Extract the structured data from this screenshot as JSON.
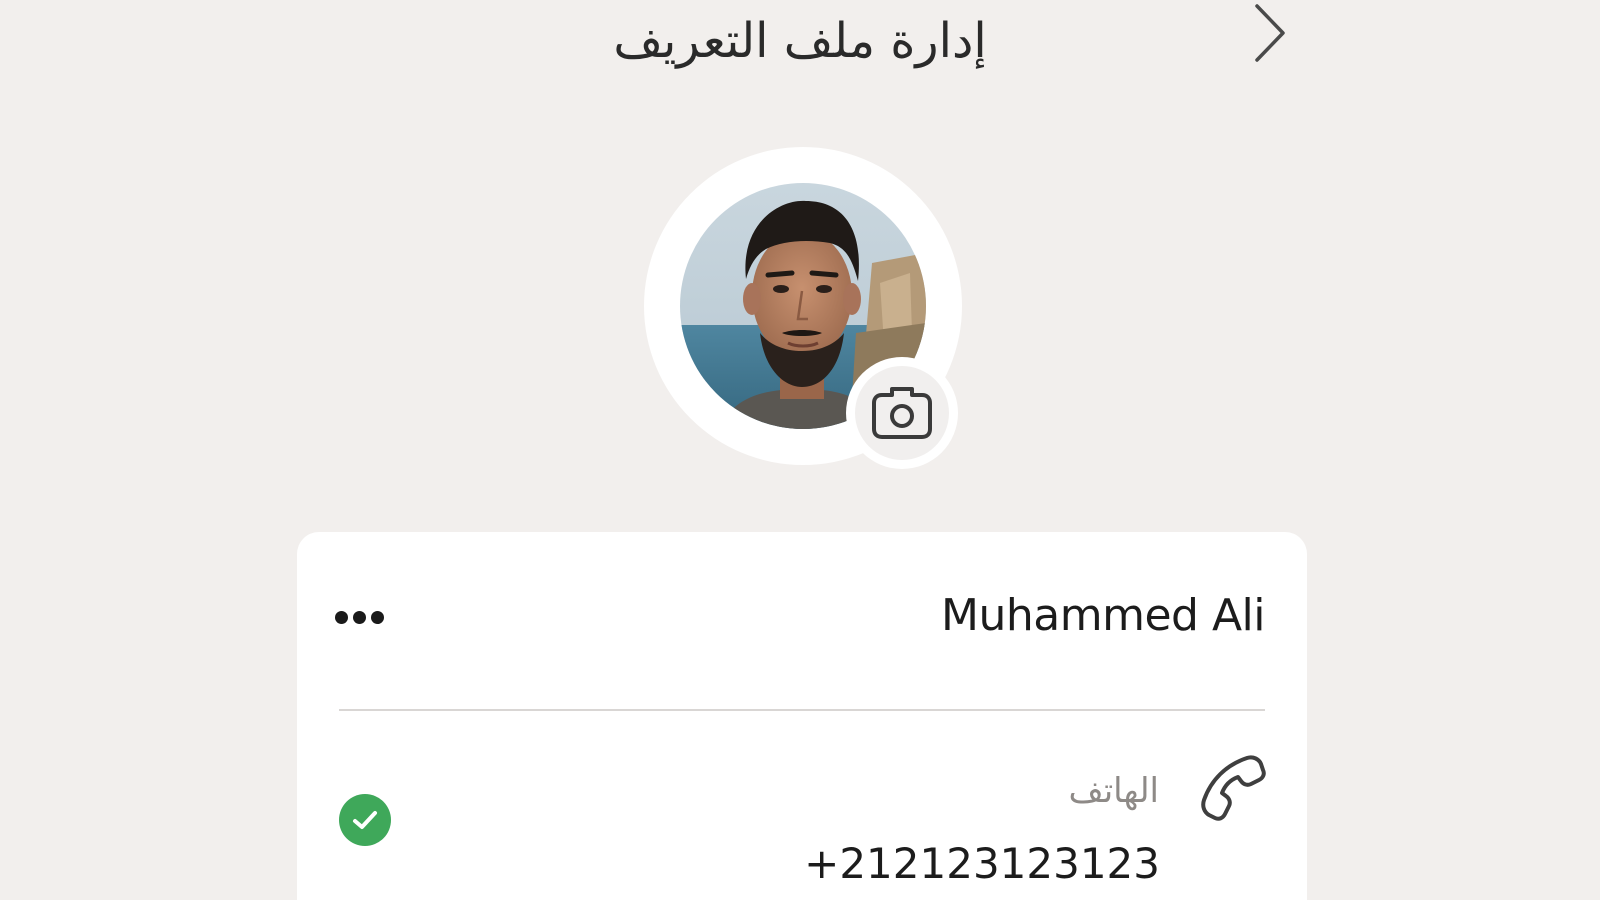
{
  "header": {
    "title": "إدارة ملف التعريف",
    "back_icon": "chevron-right-icon"
  },
  "avatar": {
    "photo": "profile-photo",
    "camera_icon": "camera-icon"
  },
  "profile": {
    "name": "Muhammed Ali",
    "more_icon": "more-horizontal-icon",
    "phone_label": "الهاتف",
    "phone_value": "+212123123123",
    "phone_icon": "phone-icon",
    "phone_verified_icon": "verified-check-icon"
  },
  "colors": {
    "background": "#f2efed",
    "card": "#ffffff",
    "verified": "#3fa85a",
    "label_gray": "#8e8a87",
    "text": "#1c1c1c"
  }
}
